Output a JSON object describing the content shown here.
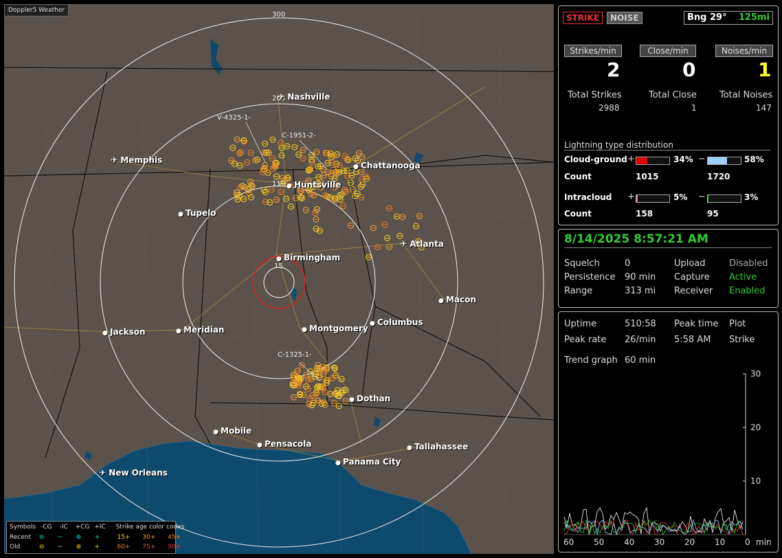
{
  "map": {
    "title": "Doppler5 Weather",
    "ring_labels": [
      "300",
      "205",
      "110",
      "15"
    ],
    "cities": [
      {
        "name": "Nashville",
        "airport": true
      },
      {
        "name": "Memphis",
        "airport": true
      },
      {
        "name": "Chattanooga",
        "airport": false
      },
      {
        "name": "Huntsville",
        "airport": false
      },
      {
        "name": "Tupelo",
        "airport": false
      },
      {
        "name": "Atlanta",
        "airport": true
      },
      {
        "name": "Birmingham",
        "airport": false
      },
      {
        "name": "Macon",
        "airport": false
      },
      {
        "name": "Jackson",
        "airport": false
      },
      {
        "name": "Meridian",
        "airport": false
      },
      {
        "name": "Montgomery",
        "airport": false
      },
      {
        "name": "Columbus",
        "airport": false
      },
      {
        "name": "Dothan",
        "airport": false
      },
      {
        "name": "Mobile",
        "airport": false
      },
      {
        "name": "Pensacola",
        "airport": false
      },
      {
        "name": "Tallahassee",
        "airport": false
      },
      {
        "name": "Panama City",
        "airport": false
      },
      {
        "name": "New Orleans",
        "airport": true
      }
    ],
    "storm_labels": [
      "V-4325-1-",
      "C-1951-2-",
      "C-1325-1-"
    ]
  },
  "legend": {
    "symbols_label": "Symbols",
    "headers": [
      "-CG",
      "-IC",
      "+CG",
      "+IC"
    ],
    "age_title": "Strike age color codes",
    "recent_label": "Recent",
    "old_label": "Old",
    "recent_ages": [
      "15+",
      "30+",
      "45+"
    ],
    "old_ages": [
      "60+",
      "75+",
      "90+"
    ]
  },
  "status": {
    "strike_btn": "STRIKE",
    "noise_btn": "NOISE",
    "bearing": "Bng 29°",
    "range": "125mi",
    "rate_labels": [
      "Strikes/min",
      "Close/min",
      "Noises/min"
    ],
    "rates": [
      "2",
      "0",
      "1"
    ],
    "total_labels": [
      "Total Strikes",
      "Total Close",
      "Total Noises"
    ],
    "totals": [
      "2988",
      "1",
      "147"
    ],
    "dist_title": "Lightning type distribution",
    "cg_label": "Cloud-ground",
    "ic_label": "Intracloud",
    "count_label": "Count",
    "plus": "+",
    "minus": "−",
    "cg_pos_pct": "34%",
    "cg_neg_pct": "58%",
    "cg_pos_count": "1015",
    "cg_neg_count": "1720",
    "ic_pos_pct": "5%",
    "ic_neg_pct": "3%",
    "ic_pos_count": "158",
    "ic_neg_count": "95",
    "cg_pos_frac": 0.34,
    "cg_neg_frac": 0.58,
    "ic_pos_frac": 0.05,
    "ic_neg_frac": 0.03
  },
  "settings": {
    "datetime": "8/14/2025 8:57:21 AM",
    "rows": [
      {
        "k1": "Squelch",
        "v1": "0",
        "k2": "Upload",
        "v2": "Disabled"
      },
      {
        "k1": "Persistence",
        "v1": "90 min",
        "k2": "Capture",
        "v2": "Active"
      },
      {
        "k1": "Range",
        "v1": "313 mi",
        "k2": "Receiver",
        "v2": "Enabled"
      }
    ]
  },
  "trend": {
    "uptime_label": "Uptime",
    "uptime": "510:58",
    "peak_time_label": "Peak time",
    "peak_time": "5:58 AM",
    "plot_label": "Plot",
    "plot": "Strike",
    "peak_rate_label": "Peak rate",
    "peak_rate": "26/min",
    "graph_label": "Trend graph",
    "graph": "60 min",
    "y_ticks": [
      "30",
      "20",
      "10"
    ],
    "x_ticks": [
      "60",
      "50",
      "40",
      "30",
      "20",
      "10",
      "0"
    ],
    "x_unit": "min"
  },
  "colors": {
    "map_bg": "#5b524c",
    "water": "#0e4a6e",
    "ring": "#f0f0f0",
    "close_ring": "#e02020",
    "recent": "#ffd21f",
    "old": "#f08020",
    "active": "#3c3",
    "cg_pos": "#e00000",
    "cg_neg": "#9cd0ff",
    "ic_pos": "#f080c0",
    "ic_neg": "#30d030"
  }
}
